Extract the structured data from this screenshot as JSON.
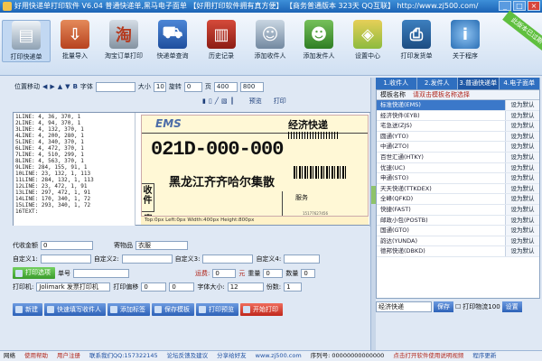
{
  "window": {
    "title": "好用快递单打印软件 V6.04 普通快递单,黑马电子面单 【好用打印软件拥有真方便】 【商务普通版本 323天 QQ互联】 http://www.zj500.com/",
    "badge": "此版本已过期"
  },
  "toolbar": {
    "items": [
      {
        "label": "打印快递单",
        "icon": "print-icon"
      },
      {
        "label": "批量导入",
        "icon": "import-icon"
      },
      {
        "label": "淘宝订单打印",
        "icon": "taobao-icon",
        "glyph": "淘"
      },
      {
        "label": "快递单查询",
        "icon": "truck-icon"
      },
      {
        "label": "历史记录",
        "icon": "history-book-icon"
      },
      {
        "label": "添加收件人",
        "icon": "add-recipient-icon"
      },
      {
        "label": "添加发件人",
        "icon": "add-sender-icon"
      },
      {
        "label": "设置中心",
        "icon": "settings-cube-icon"
      },
      {
        "label": "打印发货单",
        "icon": "invoice-printer-icon"
      },
      {
        "label": "关于程序",
        "icon": "info-icon",
        "glyph": "i"
      }
    ]
  },
  "design_controls": {
    "pos_move": "位置移动",
    "font": "字体",
    "size": "大小",
    "size_value": "10",
    "rotate": "旋转",
    "rotate_value": "0",
    "page": "页",
    "page_w": "400",
    "page_h": "800",
    "preview": "预览",
    "print": "打印"
  },
  "coords": [
    "1LINE: 4, 36, 370, 1",
    "2LINE: 4, 94, 370, 1",
    "3LINE: 4, 132, 370, 1",
    "4LINE: 4, 200, 280, 1",
    "5LINE: 4, 340, 370, 1",
    "6LINE: 4, 472, 370, 1",
    "7LINE: 4, 510, 299, 1",
    "8LINE: 4, 563, 370, 1",
    "9LINE: 284, 155, 91, 1",
    "10LINE: 23, 132, 1, 113",
    "11LINE: 284, 132, 1, 113",
    "12LINE: 23, 472, 1, 91",
    "13LINE: 297, 472, 1, 91",
    "14LINE: 170, 340, 1, 72",
    "15LINE: 293, 340, 1, 72",
    "16TEXT:"
  ],
  "label": {
    "logo": "EMS",
    "service_type": "经济快递",
    "tracking_number": "021D-000-000",
    "destination": "黑龙江齐齐哈尔集散",
    "service_box": "服务",
    "recipient": "收件",
    "sender": "寄",
    "phone": "15177627456",
    "status": "Top:0px  Left:0px  Width:400px  Height:800px"
  },
  "form": {
    "cod_label": "代收金额",
    "cod_value": "0",
    "item_label": "寄物品",
    "item_value": "衣服",
    "custom1": "自定义1:",
    "custom2": "自定义2:",
    "custom3": "自定义3:",
    "custom4": "自定义4:",
    "tracking_label": "单号",
    "tracking_value": "",
    "shipping_label": "运费:",
    "shipping_value": "0",
    "currency": "元",
    "weight_label": "重量",
    "weight_value": "0",
    "qty_label": "数量",
    "qty_value": "0",
    "print_opt": "打印选项",
    "printer_label": "打印机:",
    "printer_value": "Jolimark 发票打印机",
    "print_offset_label": "打印偏移",
    "offset_x": "0",
    "offset_y": "0",
    "font_size_label": "字体大小:",
    "font_size_value": "12",
    "copies_label": "份数:",
    "copies_value": "1"
  },
  "actions": [
    {
      "label": "新建",
      "style": "blue"
    },
    {
      "label": "快速填写收件人",
      "style": "blue"
    },
    {
      "label": "添加标签",
      "style": "blue"
    },
    {
      "label": "保存模板",
      "style": "blue"
    },
    {
      "label": "打印预览",
      "style": "blue"
    },
    {
      "label": "开始打印",
      "style": "red"
    }
  ],
  "sidepanel": {
    "tabs": [
      "1.收件人",
      "2.发件人",
      "3.普通快递单",
      "4.电子面单"
    ],
    "header": {
      "col1": "模板名称",
      "col2": "请双击模板名称选择"
    },
    "set_default": "设为默认",
    "templates": [
      "标准快递(EMS)",
      "经济快件(EYB)",
      "宅急送(ZJS)",
      "圆通(YTO)",
      "中通(ZTO)",
      "百世汇通(HTKY)",
      "优速(UC)",
      "申通(STO)",
      "天天快递(TTKDEX)",
      "全峰(QFKD)",
      "快捷(FAST)",
      "邮政小包(POSTB)",
      "国通(GTO)",
      "韵达(YUNDA)",
      "德邦快递(DBKD)"
    ],
    "selected_index": 0,
    "filter_value": "经济快递",
    "save": "保存",
    "show_all": "打印物流100",
    "set_label": "设置"
  },
  "statusbar": {
    "item1": "网络",
    "item2": "使用帮助",
    "item3": "用户注册",
    "item4": "联系我们QQ:157322145",
    "item5": "论坛反馈及建议",
    "item6": "分享给好友",
    "item7": "www.zj500.com",
    "item8": "序列号: 00000000000000",
    "item9": "点击打开软件使用说明视频",
    "item10": "程序更新"
  }
}
